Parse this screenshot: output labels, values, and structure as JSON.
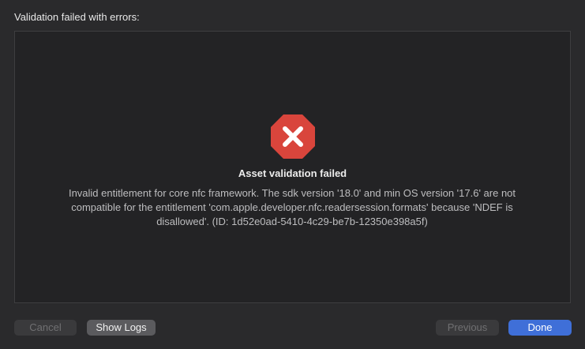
{
  "header": {
    "title": "Validation failed with errors:"
  },
  "message": {
    "icon": "error-octagon-icon",
    "title": "Asset validation failed",
    "body": "Invalid entitlement for core nfc framework. The sdk version '18.0' and min OS version '17.6' are not compatible for the entitlement 'com.apple.developer.nfc.readersession.formats' because 'NDEF is disallowed'. (ID: 1d52e0ad-5410-4c29-be7b-12350e398a5f)"
  },
  "buttons": {
    "cancel": "Cancel",
    "show_logs": "Show Logs",
    "previous": "Previous",
    "done": "Done"
  },
  "colors": {
    "background": "#2a2a2c",
    "panel": "#232325",
    "error_red": "#d9453c",
    "accent_blue": "#3f6fd8"
  }
}
